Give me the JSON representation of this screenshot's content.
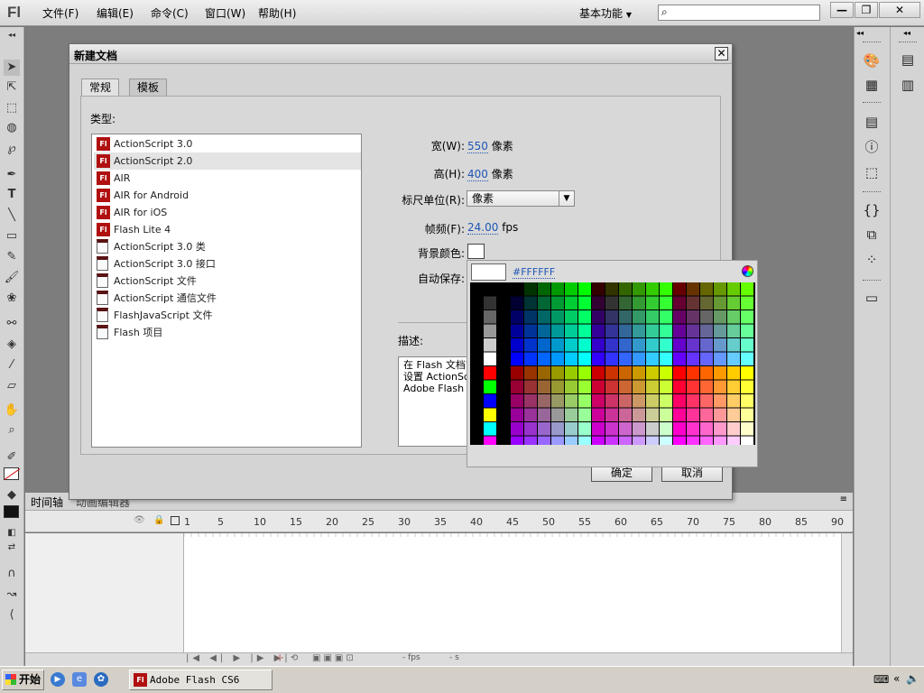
{
  "app": {
    "logo": "Fl"
  },
  "menu": [
    "文件(F)",
    "编辑(E)",
    "命令(C)",
    "窗口(W)",
    "帮助(H)"
  ],
  "workspace": "基本功能",
  "window_buttons": {
    "minimize": "—",
    "restore": "❐",
    "close": "✕"
  },
  "dialog": {
    "title": "新建文档",
    "close": "✕",
    "tabs": [
      "常规",
      "模板"
    ],
    "type_label": "类型:",
    "types": [
      {
        "label": "ActionScript 3.0",
        "kind": "fla"
      },
      {
        "label": "ActionScript 2.0",
        "kind": "fla",
        "selected": true
      },
      {
        "label": "AIR",
        "kind": "fla"
      },
      {
        "label": "AIR for Android",
        "kind": "fla"
      },
      {
        "label": "AIR for iOS",
        "kind": "fla"
      },
      {
        "label": "Flash Lite 4",
        "kind": "fla"
      },
      {
        "label": "ActionScript 3.0 类",
        "kind": "doc"
      },
      {
        "label": "ActionScript 3.0 接口",
        "kind": "doc"
      },
      {
        "label": "ActionScript 文件",
        "kind": "doc"
      },
      {
        "label": "ActionScript 通信文件",
        "kind": "doc"
      },
      {
        "label": "FlashJavaScript 文件",
        "kind": "doc"
      },
      {
        "label": "Flash 项目",
        "kind": "doc"
      }
    ],
    "width": {
      "label": "宽(W):",
      "value": "550",
      "unit": "像素"
    },
    "height": {
      "label": "高(H):",
      "value": "400",
      "unit": "像素"
    },
    "ruler": {
      "label": "标尺单位(R):",
      "value": "像素"
    },
    "fps": {
      "label": "帧频(F):",
      "value": "24.00",
      "unit": "fps"
    },
    "bgcolor": {
      "label": "背景颜色:",
      "value": "#FFFFFF"
    },
    "autosave": {
      "label": "自动保存:"
    },
    "description_label": "描述:",
    "description": "在 Flash 文档窗\n设置 ActionScr\nAdobe Flash Pla",
    "ok": "确定",
    "cancel": "取消"
  },
  "color_picker": {
    "hex": "#FFFFFF"
  },
  "timeline": {
    "tabs": [
      "时间轴",
      "动画编辑器"
    ],
    "frame_numbers": [
      "1",
      "5",
      "10",
      "15",
      "20",
      "25",
      "30",
      "35",
      "40",
      "45",
      "50",
      "55",
      "60",
      "65",
      "70",
      "75",
      "80",
      "85",
      "90"
    ],
    "status": {
      "fps": "- fps",
      "sec": "- s"
    }
  },
  "taskbar": {
    "start": "开始",
    "task": "Adobe Flash CS6"
  }
}
